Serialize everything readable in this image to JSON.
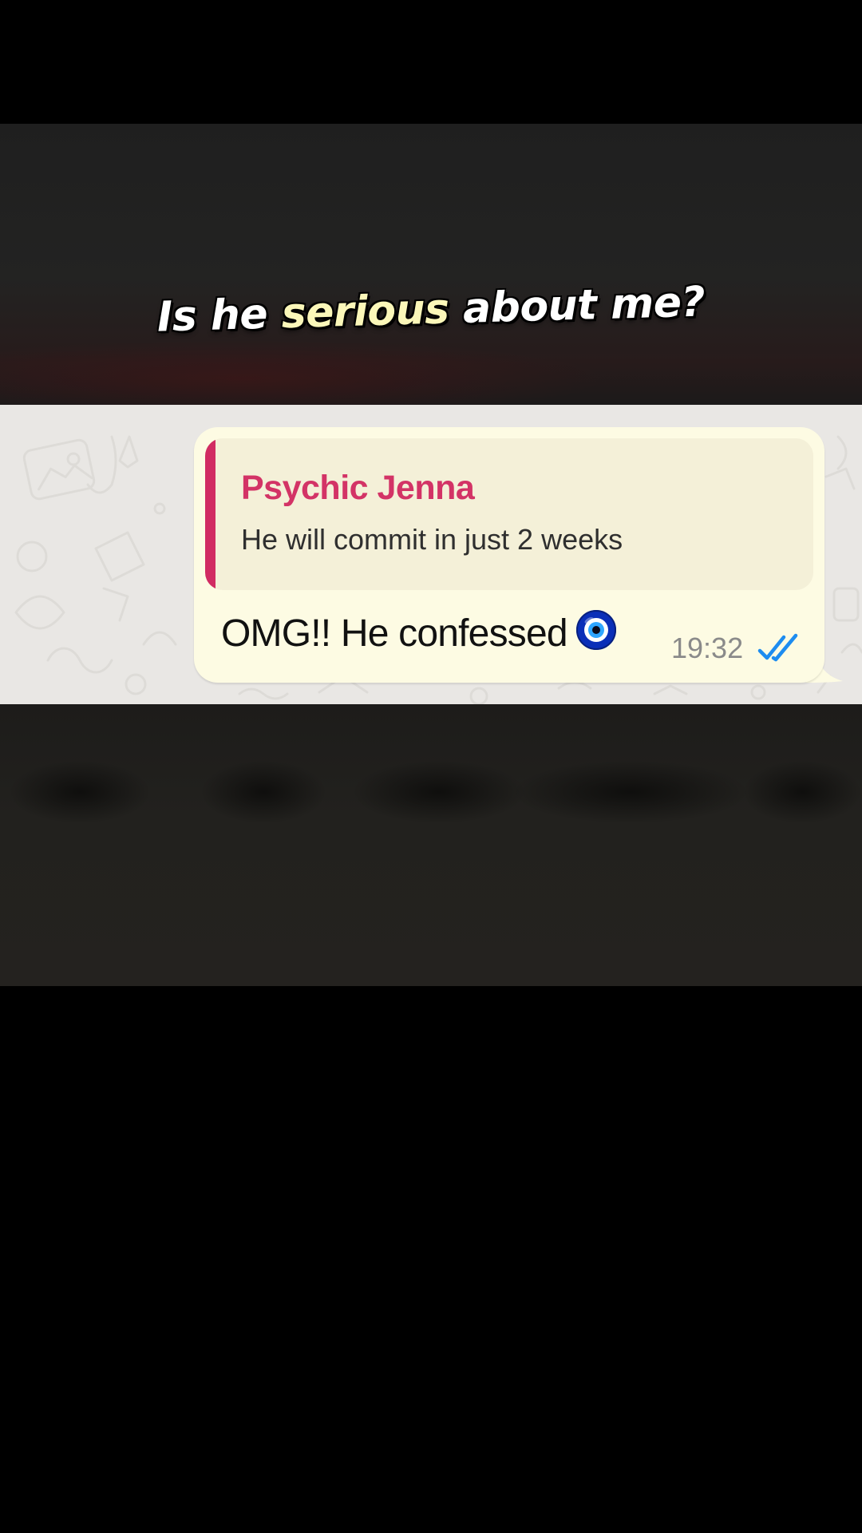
{
  "caption": {
    "before": "Is he ",
    "highlight": "serious",
    "after": " about me?"
  },
  "message": {
    "quote_author": "Psychic Jenna",
    "quote_text": "He will commit in just 2 weeks",
    "text": "OMG!! He confessed",
    "emoji_icon": "nazar-amulet-icon",
    "time": "19:32",
    "status_icon": "double-check-read-icon"
  },
  "colors": {
    "bubble": "#fdfbe3",
    "quote_bar": "#d12b62",
    "quote_author": "#d33366",
    "read_ticks": "#1d8cf0",
    "caption_highlight": "#fbf7b9"
  }
}
